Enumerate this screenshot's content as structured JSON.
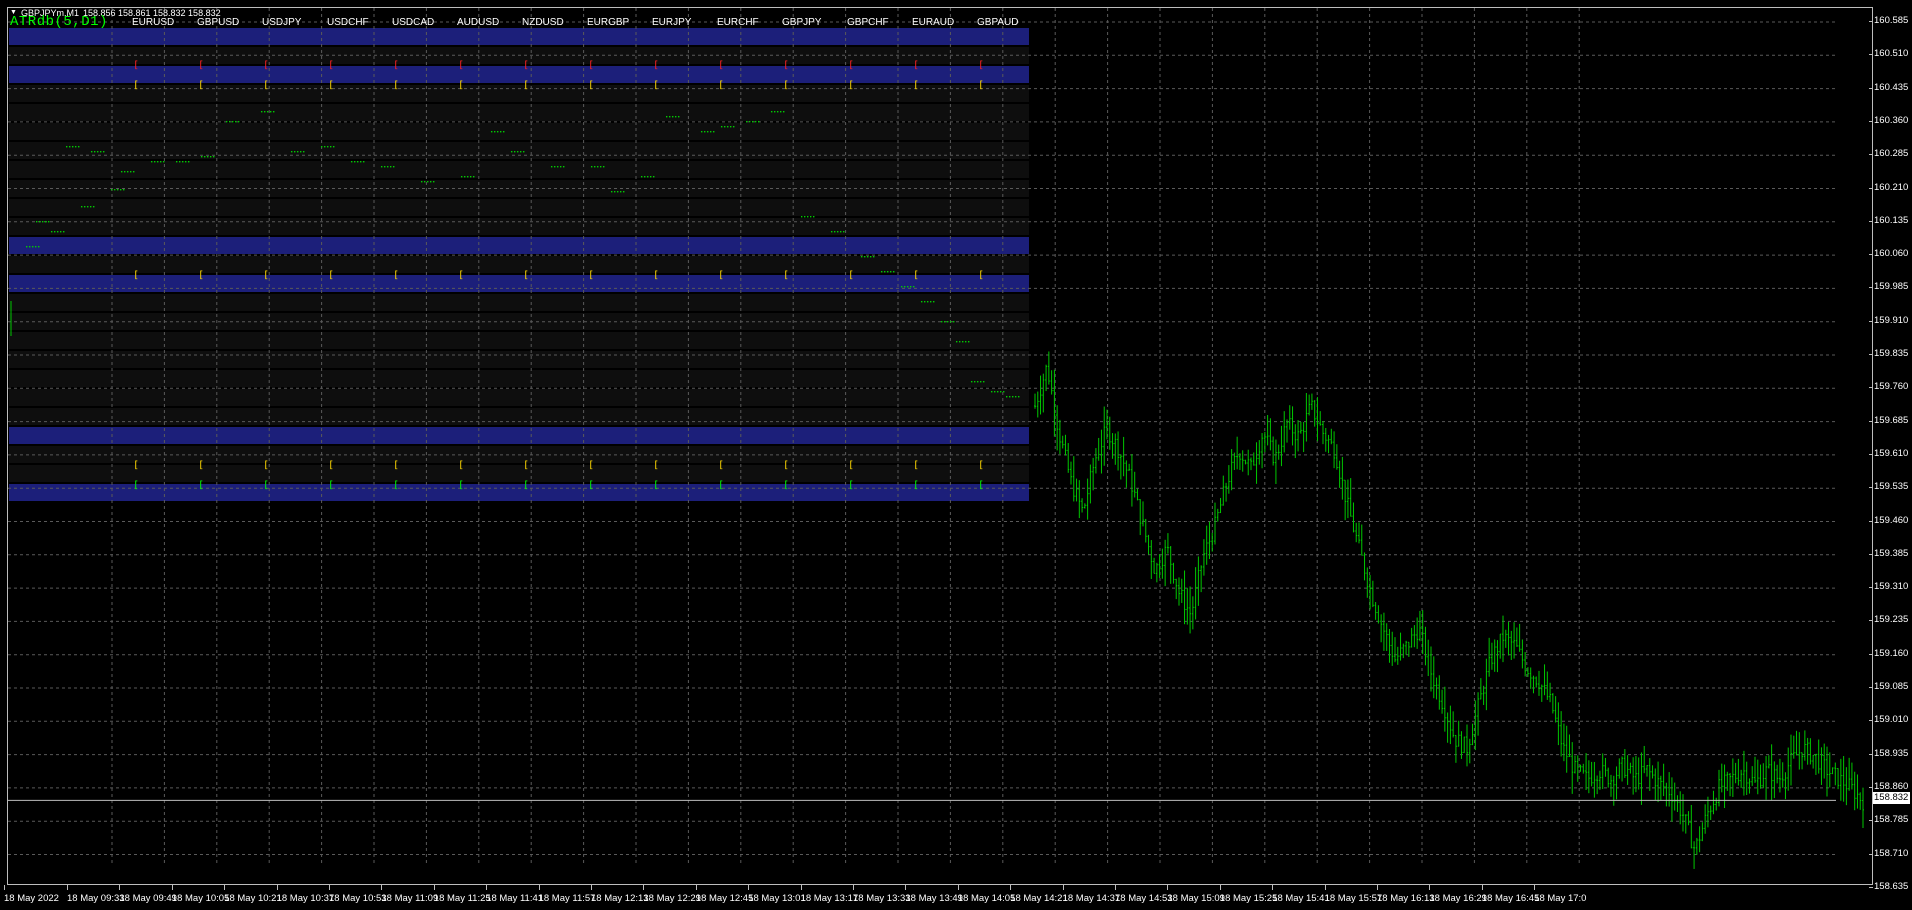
{
  "window": {
    "title_symbol": "GBPJPYm,M1",
    "title_ohlc": "158.856 158.861 158.832 158.832",
    "indicator_label": "ATRdb(5,D1)"
  },
  "colors": {
    "background": "#000000",
    "grid": "#5a5a5a",
    "candle": "#00c800",
    "band_blue": "#1c1f7a",
    "band_dark": "#101010",
    "bracket_red": "#ff2020",
    "bracket_yellow": "#ffd800",
    "bracket_green": "#00ff00",
    "dots": "#00cc00"
  },
  "pairs": [
    "EURUSD",
    "GBPUSD",
    "USDJPY",
    "USDCHF",
    "USDCAD",
    "AUDUSD",
    "NZDUSD",
    "EURGBP",
    "EURJPY",
    "EURCHF",
    "GBPJPY",
    "GBPCHF",
    "EURAUD",
    "GBPAUD"
  ],
  "price_axis": {
    "labels": [
      "160.585",
      "160.510",
      "160.435",
      "160.360",
      "160.285",
      "160.210",
      "160.135",
      "160.060",
      "159.985",
      "159.910",
      "159.835",
      "159.760",
      "159.685",
      "159.610",
      "159.535",
      "159.460",
      "159.385",
      "159.310",
      "159.235",
      "159.160",
      "159.085",
      "159.010",
      "158.935",
      "158.860",
      "158.785",
      "158.710",
      "158.635"
    ],
    "current_price": "158.832"
  },
  "time_axis": {
    "labels": [
      "18 May 2022",
      "18 May 09:33",
      "18 May 09:49",
      "18 May 10:05",
      "18 May 10:21",
      "18 May 10:37",
      "18 May 10:53",
      "18 May 11:09",
      "18 May 11:25",
      "18 May 11:41",
      "18 May 11:57",
      "18 May 12:13",
      "18 May 12:29",
      "18 May 12:45",
      "18 May 13:01",
      "18 May 13:17",
      "18 May 13:33",
      "18 May 13:49",
      "18 May 14:05",
      "18 May 14:21",
      "18 May 14:37",
      "18 May 14:53",
      "18 May 15:09",
      "18 May 15:25",
      "18 May 15:41",
      "18 May 15:57",
      "18 May 16:13",
      "18 May 16:29",
      "18 May 16:45",
      "18 May 17:0"
    ]
  },
  "chart_data": {
    "type": "candlestick",
    "symbol": "GBPJPYm",
    "timeframe": "M1",
    "ylim": [
      158.635,
      160.585
    ],
    "close_path": [
      [
        13.33,
        159.72
      ],
      [
        13.36,
        159.81
      ],
      [
        13.38,
        159.66
      ],
      [
        13.41,
        159.55
      ],
      [
        13.43,
        159.48
      ],
      [
        13.46,
        159.6
      ],
      [
        13.49,
        159.67
      ],
      [
        13.52,
        159.62
      ],
      [
        13.55,
        159.55
      ],
      [
        13.58,
        159.45
      ],
      [
        14.0,
        159.35
      ],
      [
        14.03,
        159.4
      ],
      [
        14.06,
        159.3
      ],
      [
        14.08,
        159.25
      ],
      [
        14.11,
        159.38
      ],
      [
        14.14,
        159.45
      ],
      [
        14.17,
        159.55
      ],
      [
        14.2,
        159.62
      ],
      [
        14.23,
        159.58
      ],
      [
        14.26,
        159.66
      ],
      [
        14.29,
        159.6
      ],
      [
        14.32,
        159.68
      ],
      [
        14.35,
        159.65
      ],
      [
        14.37,
        159.72
      ],
      [
        14.4,
        159.66
      ],
      [
        14.43,
        159.62
      ],
      [
        14.46,
        159.5
      ],
      [
        14.49,
        159.4
      ],
      [
        14.52,
        159.3
      ],
      [
        14.55,
        159.22
      ],
      [
        14.58,
        159.15
      ],
      [
        15.01,
        159.18
      ],
      [
        15.04,
        159.22
      ],
      [
        15.07,
        159.12
      ],
      [
        15.1,
        159.05
      ],
      [
        15.13,
        158.97
      ],
      [
        15.16,
        158.95
      ],
      [
        15.19,
        159.05
      ],
      [
        15.22,
        159.15
      ],
      [
        15.25,
        159.2
      ],
      [
        15.28,
        159.18
      ],
      [
        15.31,
        159.13
      ],
      [
        15.34,
        159.1
      ],
      [
        15.37,
        159.05
      ],
      [
        15.4,
        158.95
      ],
      [
        15.43,
        158.9
      ],
      [
        15.46,
        158.88
      ],
      [
        15.49,
        158.9
      ],
      [
        15.52,
        158.88
      ],
      [
        15.55,
        158.91
      ],
      [
        15.58,
        158.88
      ],
      [
        16.01,
        158.9
      ],
      [
        16.04,
        158.87
      ],
      [
        16.07,
        158.85
      ],
      [
        16.1,
        158.8
      ],
      [
        16.13,
        158.72
      ],
      [
        16.16,
        158.8
      ],
      [
        16.19,
        158.86
      ],
      [
        16.22,
        158.88
      ],
      [
        16.25,
        158.9
      ],
      [
        16.28,
        158.87
      ],
      [
        16.31,
        158.9
      ],
      [
        16.34,
        158.88
      ],
      [
        16.37,
        158.92
      ],
      [
        16.4,
        158.95
      ],
      [
        16.43,
        158.93
      ],
      [
        16.46,
        158.9
      ],
      [
        16.49,
        158.88
      ],
      [
        16.52,
        158.86
      ],
      [
        16.55,
        158.83
      ]
    ]
  },
  "indicator_panel": {
    "name": "ATRdb(5,D1)",
    "pairs": [
      "EURUSD",
      "GBPUSD",
      "USDJPY",
      "USDCHF",
      "USDCAD",
      "AUDUSD",
      "NZDUSD",
      "EURGBP",
      "EURJPY",
      "EURCHF",
      "GBPJPY",
      "GBPCHF",
      "EURAUD",
      "GBPAUD"
    ]
  }
}
